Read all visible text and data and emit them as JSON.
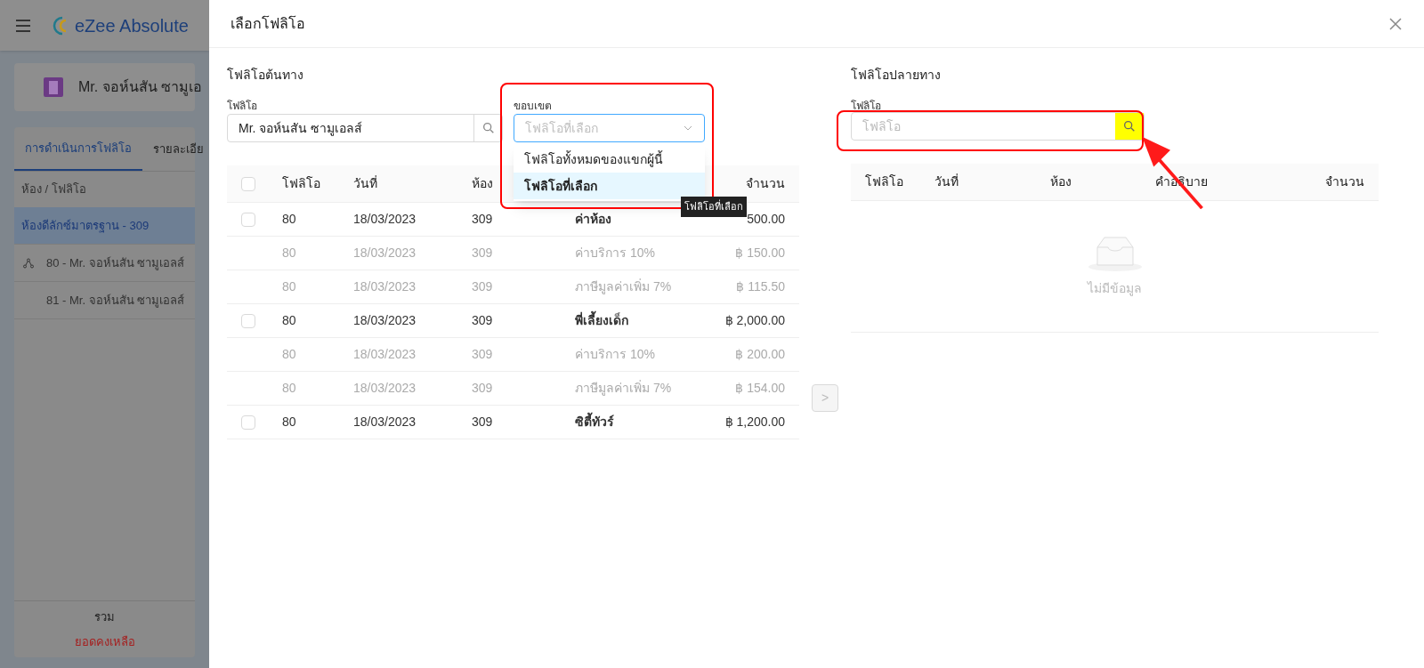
{
  "background": {
    "app_name": "eZee Absolute",
    "guest_title": "Mr. จอห์นสัน ซามูเอ",
    "tabs": [
      {
        "label": "การดำเนินการโฟลิโอ",
        "selected": true
      },
      {
        "label": "รายละเอีย",
        "selected": false
      }
    ],
    "list_header": "ห้อง / โฟลิโอ",
    "rows": [
      {
        "kind": "room",
        "label": "ห้องดีลักซ์มาตรฐาน - 309",
        "selected": true
      },
      {
        "kind": "folio",
        "label": "80 - Mr. จอห์นสัน ซามูเอลส์",
        "selected": false,
        "shared": true
      },
      {
        "kind": "folio",
        "label": "81 - Mr. จอห์นสัน ซามูเอลส์",
        "selected": false,
        "shared": false
      }
    ],
    "total_label": "รวม",
    "balance_label": "ยอดคงเหลือ"
  },
  "dialog": {
    "title": "เลือกโฟลิโอ"
  },
  "source": {
    "heading": "โฟลิโอต้นทาง",
    "folio_label": "โฟลิโอ",
    "folio_value": "Mr. จอห์นสัน ซามูเอลส์",
    "scope_label": "ขอบเขต",
    "scope_placeholder": "โฟลิโอที่เลือก",
    "scope_options": [
      {
        "label": "โฟลิโอทั้งหมดของแขกผู้นี้",
        "selected": false
      },
      {
        "label": "โฟลิโอที่เลือก",
        "selected": true
      }
    ],
    "tooltip": "โฟลิโอที่เลือก",
    "columns": [
      "โฟลิโอ",
      "วันที่",
      "ห้อง",
      "จำนวน"
    ],
    "all_checked": false,
    "rows": [
      {
        "kind": "charge",
        "checked": false,
        "folio": "80",
        "date": "18/03/2023",
        "room": "309",
        "description": "ค่าห้อง",
        "amount": "500.00"
      },
      {
        "kind": "tax",
        "folio": "80",
        "date": "18/03/2023",
        "room": "309",
        "description": "ค่าบริการ 10%",
        "amount": "฿ 150.00"
      },
      {
        "kind": "tax",
        "folio": "80",
        "date": "18/03/2023",
        "room": "309",
        "description": "ภาษีมูลค่าเพิ่ม 7%",
        "amount": "฿ 115.50"
      },
      {
        "kind": "charge",
        "checked": false,
        "folio": "80",
        "date": "18/03/2023",
        "room": "309",
        "description": "พี่เลี้ยงเด็ก",
        "amount": "฿ 2,000.00"
      },
      {
        "kind": "tax",
        "folio": "80",
        "date": "18/03/2023",
        "room": "309",
        "description": "ค่าบริการ 10%",
        "amount": "฿ 200.00"
      },
      {
        "kind": "tax",
        "folio": "80",
        "date": "18/03/2023",
        "room": "309",
        "description": "ภาษีมูลค่าเพิ่ม 7%",
        "amount": "฿ 154.00"
      },
      {
        "kind": "charge",
        "checked": false,
        "folio": "80",
        "date": "18/03/2023",
        "room": "309",
        "description": "ซิตี้ทัวร์",
        "amount": "฿ 1,200.00"
      }
    ]
  },
  "move_button": {
    "label": ">",
    "disabled": true
  },
  "destination": {
    "heading": "โฟลิโอปลายทาง",
    "folio_label": "โฟลิโอ",
    "folio_placeholder": "โฟลิโอ",
    "columns": [
      "โฟลิโอ",
      "วันที่",
      "ห้อง",
      "คำอธิบาย",
      "จำนวน"
    ],
    "empty_text": "ไม่มีข้อมูล"
  }
}
